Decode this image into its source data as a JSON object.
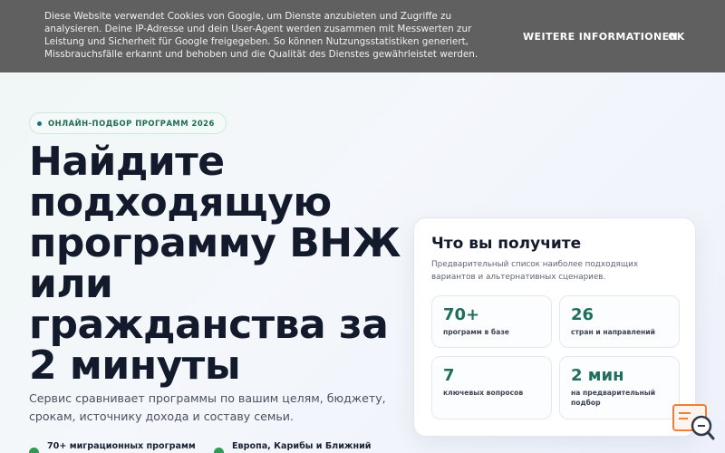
{
  "cookie": {
    "text": "Diese Website verwendet Cookies von Google, um Dienste anzubieten und Zugriffe zu analysieren. Deine IP-Adresse und dein User-Agent werden zusammen mit Messwerten zur Leistung und Sicherheit für Google freigegeben. So können Nutzungsstatistiken generiert, Missbrauchsfälle erkannt und behoben und die Qualität des Dienstes gewährleistet werden.",
    "more_label": "WEITERE INFORMATIONEN",
    "ok_label": "OK"
  },
  "hero": {
    "badge": "ОНЛАЙН-ПОДБОР ПРОГРАММ 2026",
    "title": "Найдите подходящую программу ВНЖ или гражданства за 2 минуты",
    "subtitle": "Сервис сравнивает программы по вашим целям, бюджету, срокам, источнику дохода и составу семьи.",
    "features": [
      {
        "text": "70+ миграционных программ"
      },
      {
        "text": "Европа, Карибы и Ближний Восток"
      }
    ]
  },
  "card": {
    "title": "Что вы получите",
    "description": "Предварительный список наиболее подходящих вариантов и альтернативных сценариев.",
    "stats": [
      {
        "value": "70+",
        "label": "программ в базе"
      },
      {
        "value": "26",
        "label": "стран и направлений"
      },
      {
        "value": "7",
        "label": "ключевых вопросов"
      },
      {
        "value": "2 мин",
        "label": "на предварительный подбор"
      }
    ]
  },
  "colors": {
    "accent": "#1f6e5e",
    "cookie_bg": "#606060",
    "check": "#2e9a55"
  },
  "icons": {
    "badge_dot": "dot-icon",
    "feature_check": "check-circle-icon",
    "widget": "search-chat-icon"
  }
}
